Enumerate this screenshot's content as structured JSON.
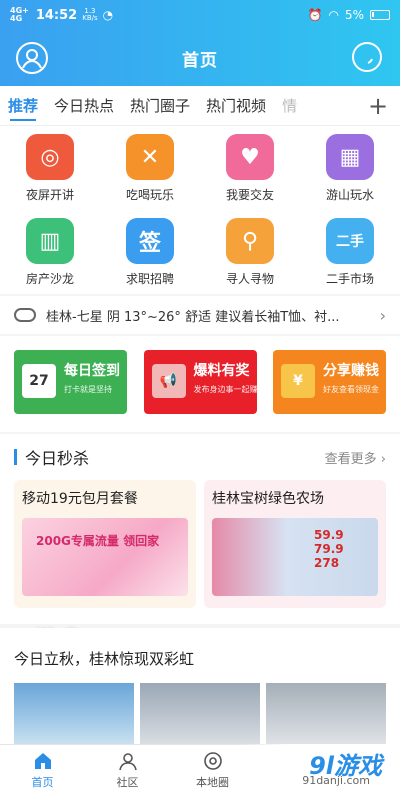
{
  "status_bar": {
    "net1": "4G+",
    "net2": "4G",
    "time": "14:52",
    "speed_value": "1.3",
    "speed_unit": "KB/s",
    "battery": "5%"
  },
  "header": {
    "title": "首页"
  },
  "tabs": [
    "推荐",
    "今日热点",
    "热门圈子",
    "热门视频",
    "情"
  ],
  "grid": [
    {
      "label": "夜屏开讲",
      "icon": "camera-shutter-icon",
      "color": "#f05a3c",
      "glyph": "◎"
    },
    {
      "label": "吃喝玩乐",
      "icon": "fork-knife-icon",
      "color": "#f5922a",
      "glyph": "✕"
    },
    {
      "label": "我要交友",
      "icon": "heart-handshake-icon",
      "color": "#f06a9a",
      "glyph": "♥"
    },
    {
      "label": "游山玩水",
      "icon": "calendar-icon",
      "color": "#9b6fe0",
      "glyph": "▦"
    },
    {
      "label": "房产沙龙",
      "icon": "buildings-icon",
      "color": "#3cc07a",
      "glyph": "▥"
    },
    {
      "label": "求职招聘",
      "icon": "sign-icon",
      "color": "#3a9df0",
      "glyph": "签"
    },
    {
      "label": "寻人寻物",
      "icon": "magnifier-icon",
      "color": "#f5a23a",
      "glyph": "⚲"
    },
    {
      "label": "二手市场",
      "icon": "secondhand-icon",
      "color": "#45b0f0",
      "glyph": "二手"
    }
  ],
  "weather": {
    "text": "桂林-七星 阴 13°~26° 舒适 建议着长袖T恤、衬..."
  },
  "promos": [
    {
      "title": "每日签到",
      "sub": "打卡就是坚持",
      "color": "#3db054",
      "icon_text": "27",
      "icon_color": "#ffffff",
      "icon_text_color": "#333333"
    },
    {
      "title": "爆料有奖",
      "sub": "发布身边事一起赚钱",
      "color": "#e8202a",
      "icon_text": "📢",
      "icon_color": "#f2b8b8",
      "icon_text_color": "#e8202a"
    },
    {
      "title": "分享赚钱",
      "sub": "好友查看领现金",
      "color": "#f5861f",
      "icon_text": "¥",
      "icon_color": "#f7c54a",
      "icon_text_color": "#ffffff"
    }
  ],
  "flash": {
    "title": "今日秒杀",
    "more": "查看更多",
    "cards": [
      {
        "title": "移动19元包月套餐",
        "bg": "#fdf5ea",
        "img_text": "200G专属流量 领回家"
      },
      {
        "title": "桂林宝树绿色农场",
        "bg": "#fdeef2",
        "img_text": "59.9 79.9 278"
      }
    ]
  },
  "news": {
    "title": "今日立秋，桂林惊现双彩虹"
  },
  "watermark": "9l游戏",
  "bottom_nav": [
    {
      "label": "首页",
      "icon": "home-icon"
    },
    {
      "label": "社区",
      "icon": "community-icon"
    },
    {
      "label": "本地圈",
      "icon": "local-circle-icon"
    }
  ],
  "brand": {
    "logo": "9l游戏",
    "url": "91danji.com"
  }
}
